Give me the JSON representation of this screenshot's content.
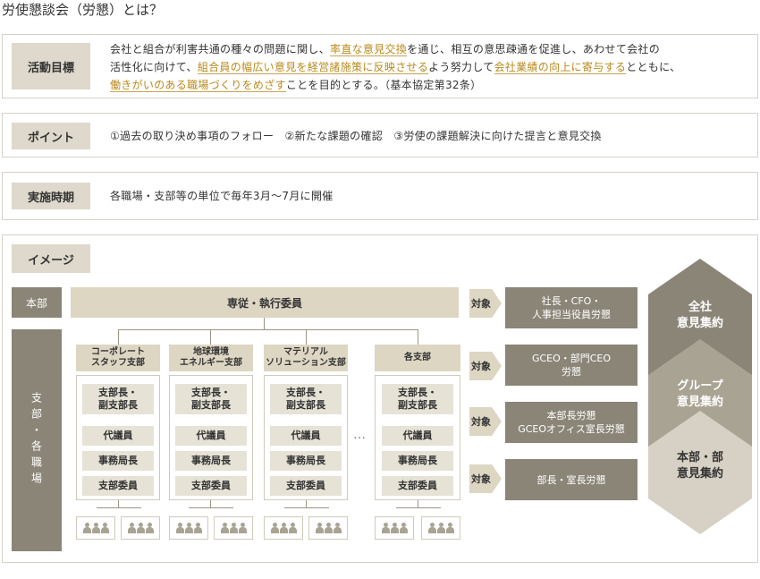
{
  "title": "労使懇談会（労懇）とは？",
  "activity": {
    "label": "活動目標",
    "t1": "会社と組合が利害共通の種々の問題に関し、",
    "h1": "率直な意見交換",
    "t2": "を通じ、相互の意思疎通を促進し、あわせて会社の",
    "t3": "活性化に向けて、",
    "h2": "組合員の幅広い意見を経営諸施策に反映させる",
    "t4": "よう努力して",
    "h3": "会社業績の向上に寄与する",
    "t5": "とともに、",
    "h4": "働きがいのある職場づくりをめざす",
    "t6": "ことを目的とする。（基本協定第32条）"
  },
  "points": {
    "label": "ポイント",
    "text": "①過去の取り決め事項のフォロー　②新たな課題の確認　③労使の課題解決に向けた提言と意見交換"
  },
  "timing": {
    "label": "実施時期",
    "text": "各職場・支部等の単位で毎年3月〜7月に開催"
  },
  "image": {
    "label": "イメージ",
    "hq_label": "本部",
    "branch_label": "支部・各職場",
    "hq_bar": "専従・執行委員",
    "divisions": [
      {
        "name": "コーポレート\nスタッフ支部"
      },
      {
        "name": "地球環境\nエネルギー支部"
      },
      {
        "name": "マテリアル\nソリューション支部"
      },
      {
        "name": "各支部"
      }
    ],
    "roles": [
      "支部長・\n副支部長",
      "代議員",
      "事務局長",
      "支部委員"
    ],
    "ellipsis": "…",
    "target_word": "対象",
    "targets": [
      "社長・CFO・\n人事担当役員労懇",
      "GCEO・部門CEO\n労懇",
      "本部長労懇\nGCEOオフィス室長労懇",
      "部長・室長労懇"
    ],
    "levels": [
      "全社\n意見集約",
      "グループ\n意見集約",
      "本部・部\n意見集約"
    ]
  },
  "colors": {
    "dark": "#8b8578",
    "mid": "#a9a393",
    "light": "#ddd6c3",
    "highlight": "#b88a1c"
  }
}
